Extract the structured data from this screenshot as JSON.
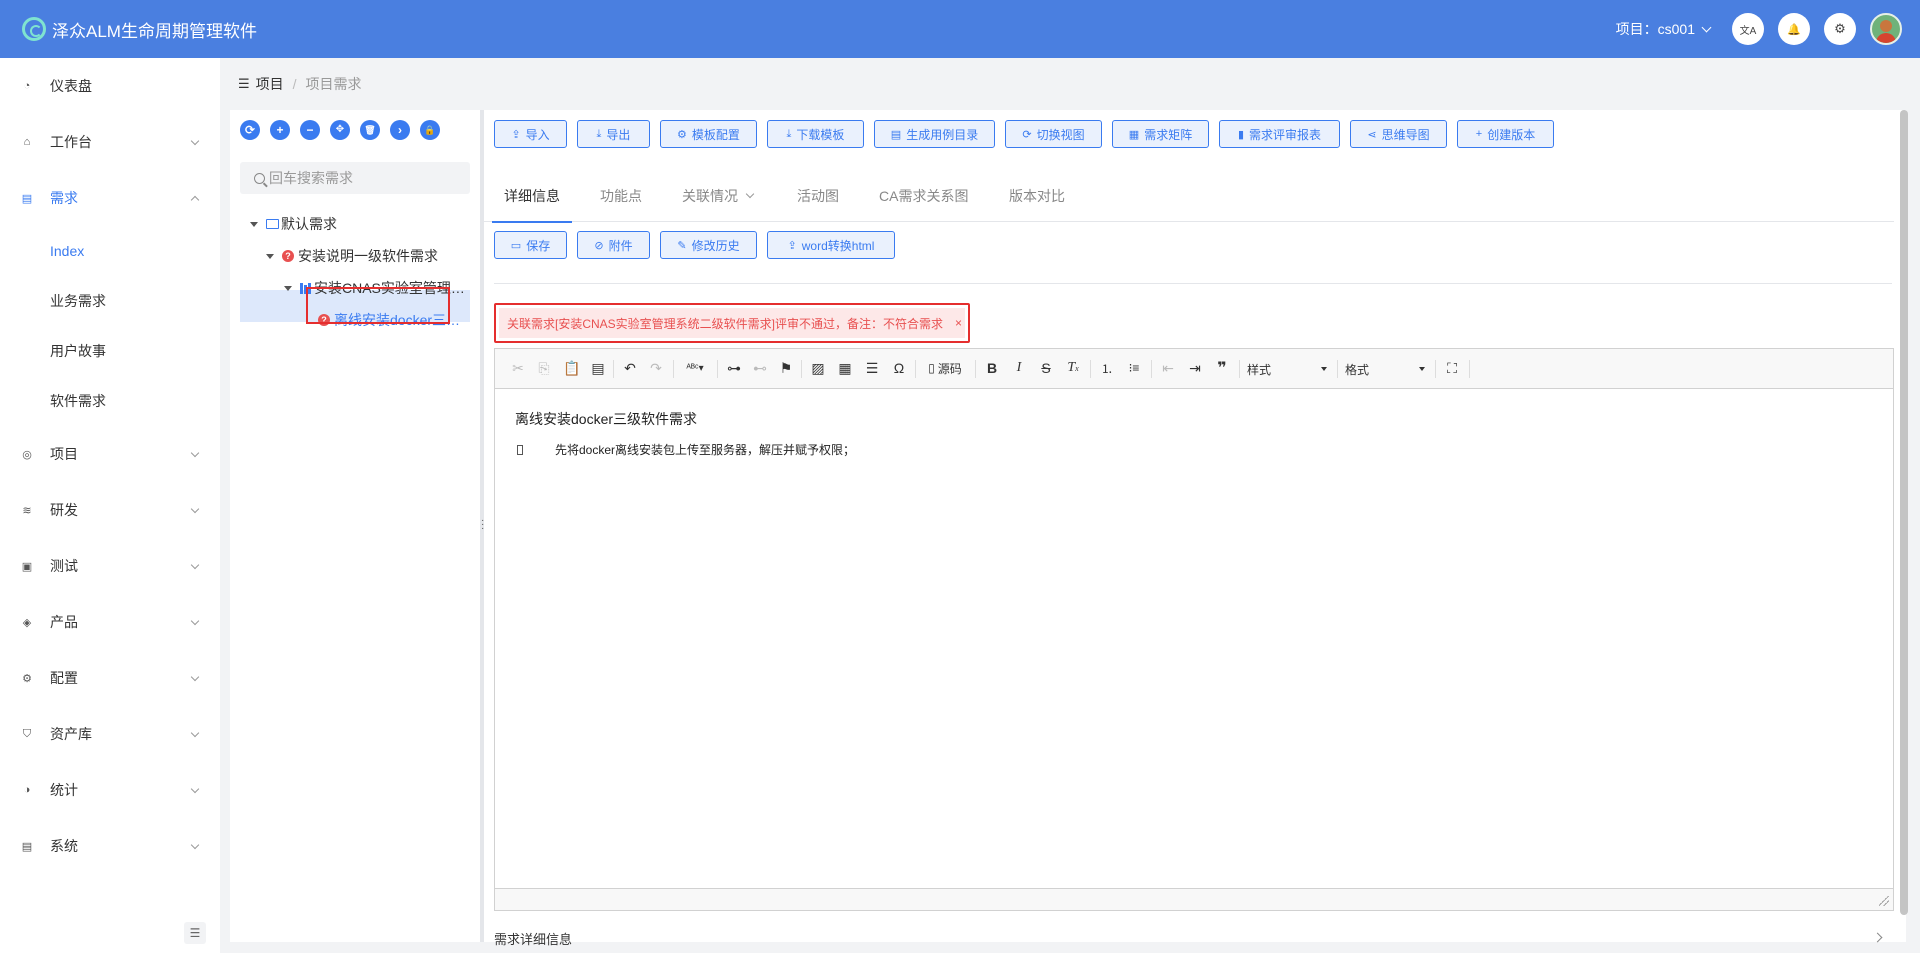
{
  "app": {
    "title": "泽众ALM生命周期管理软件"
  },
  "header": {
    "project_label": "项目：cs001",
    "translate_icon": "文A",
    "bell_icon": "🔔",
    "gear_icon": "⚙"
  },
  "sidebar": {
    "items": [
      {
        "label": "仪表盘",
        "icon": "dashboard-icon"
      },
      {
        "label": "工作台",
        "icon": "home-icon"
      },
      {
        "label": "需求",
        "icon": "requirement-icon"
      },
      {
        "label": "项目",
        "icon": "database-icon"
      },
      {
        "label": "研发",
        "icon": "layers-icon"
      },
      {
        "label": "测试",
        "icon": "clipboard-icon"
      },
      {
        "label": "产品",
        "icon": "stack-icon"
      },
      {
        "label": "配置",
        "icon": "gear-icon"
      },
      {
        "label": "资产库",
        "icon": "shield-icon"
      },
      {
        "label": "统计",
        "icon": "pie-icon"
      },
      {
        "label": "系统",
        "icon": "list-icon"
      }
    ],
    "submenu": [
      {
        "label": "Index"
      },
      {
        "label": "业务需求"
      },
      {
        "label": "用户故事"
      },
      {
        "label": "软件需求"
      }
    ]
  },
  "breadcrumb": {
    "root": "项目",
    "sep": "/",
    "current": "项目需求"
  },
  "tree": {
    "search_placeholder": "回车搜索需求",
    "toolbar_icons": [
      "⟳",
      "+",
      "−",
      "✥",
      "🗑",
      "›",
      "🔒"
    ],
    "nodes": [
      {
        "label": "默认需求"
      },
      {
        "label": "安装说明一级软件需求"
      },
      {
        "label": "安装CNAS实验室管理…"
      },
      {
        "label": "离线安装docker三…"
      }
    ]
  },
  "toolbar": {
    "buttons": [
      {
        "label": "导入",
        "icon": "⇪"
      },
      {
        "label": "导出",
        "icon": "⤓"
      },
      {
        "label": "模板配置",
        "icon": "⚙"
      },
      {
        "label": "下载模板",
        "icon": "⤓"
      },
      {
        "label": "生成用例目录",
        "icon": "▤"
      },
      {
        "label": "切换视图",
        "icon": "⟳"
      },
      {
        "label": "需求矩阵",
        "icon": "▦"
      },
      {
        "label": "需求评审报表",
        "icon": "▮"
      },
      {
        "label": "思维导图",
        "icon": "⋖"
      },
      {
        "label": "创建版本",
        "icon": "+"
      }
    ]
  },
  "tabs": [
    {
      "label": "详细信息"
    },
    {
      "label": "功能点"
    },
    {
      "label": "关联情况"
    },
    {
      "label": "活动图"
    },
    {
      "label": "CA需求关系图"
    },
    {
      "label": "版本对比"
    }
  ],
  "actions": [
    {
      "label": "保存",
      "icon": "▭"
    },
    {
      "label": "附件",
      "icon": "⊘"
    },
    {
      "label": "修改历史",
      "icon": "✎"
    },
    {
      "label": "word转换html",
      "icon": "⇪"
    }
  ],
  "alert": {
    "message": "关联需求[安装CNAS实验室管理系统二级软件需求]评审不通过，备注：不符合需求",
    "close": "×"
  },
  "editor": {
    "toolbar": {
      "source_label": "源码",
      "style_label": "样式",
      "format_label": "格式"
    },
    "heading": "离线安装docker三级软件需求",
    "paragraph": "先将docker离线安装包上传至服务器，解压并赋予权限；"
  },
  "footer": {
    "label": "需求详细信息"
  },
  "colors": {
    "primary": "#3a7bf0",
    "header_bg": "#4a7fe0",
    "alert": "#e52e2e"
  }
}
